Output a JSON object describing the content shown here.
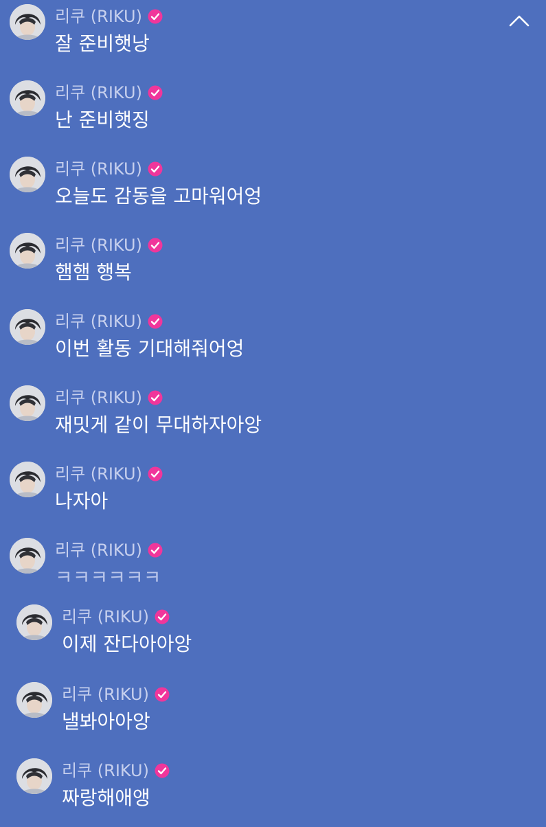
{
  "header": {
    "collapse_icon": "chevron-up-icon"
  },
  "colors": {
    "background": "#4e6fbe",
    "sender_text": "#c7d0ee",
    "message_text": "#ffffff",
    "badge": "#f0369b"
  },
  "messages": [
    {
      "sender": "리쿠 (RIKU)",
      "verified": true,
      "text": "잘 준비햇낭"
    },
    {
      "sender": "리쿠 (RIKU)",
      "verified": true,
      "text": "난 준비햇징"
    },
    {
      "sender": "리쿠 (RIKU)",
      "verified": true,
      "text": "오늘도 감동을 고마워어엉"
    },
    {
      "sender": "리쿠 (RIKU)",
      "verified": true,
      "text": "햄햄 행복"
    },
    {
      "sender": "리쿠 (RIKU)",
      "verified": true,
      "text": "이번 활동 기대해줘어엉"
    },
    {
      "sender": "리쿠 (RIKU)",
      "verified": true,
      "text": "재밋게 같이 무대하자아앙"
    },
    {
      "sender": "리쿠 (RIKU)",
      "verified": true,
      "text": "나자아"
    },
    {
      "sender": "리쿠 (RIKU)",
      "verified": true,
      "text": "ㅋㅋㅋㅋㅋㅋ"
    },
    {
      "sender": "리쿠 (RIKU)",
      "verified": true,
      "text": "이제 잔다아아앙"
    },
    {
      "sender": "리쿠 (RIKU)",
      "verified": true,
      "text": "낼봐아아앙"
    },
    {
      "sender": "리쿠 (RIKU)",
      "verified": true,
      "text": "짜랑해애앵"
    }
  ]
}
